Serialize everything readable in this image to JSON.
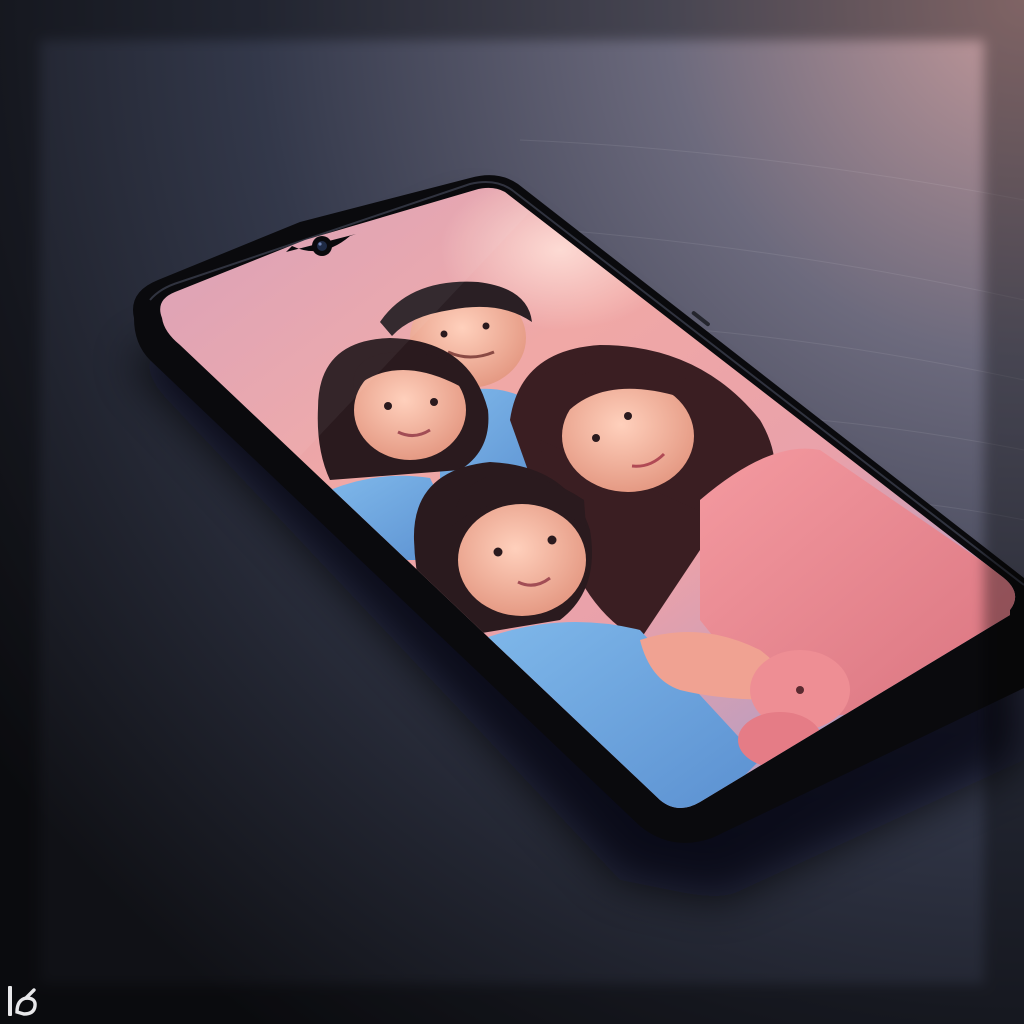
{
  "scene": {
    "subject": "smartphone-with-family-photo",
    "icons": [
      "camera-notch-icon",
      "generator-logo-icon"
    ]
  },
  "palette": {
    "table_dark": "#101116",
    "table_mid": "#33384a",
    "light_warm": "#c4999a",
    "bezel": "#0a0a0d",
    "screen_bg_top": "#e7a2ae",
    "screen_bg_bottom": "#9aa3d6",
    "shirt_blue": "#6aa7dc",
    "shirt_pink": "#ec8f98",
    "hair_dark": "#2a1a1e",
    "skin": "#f2b19a"
  }
}
